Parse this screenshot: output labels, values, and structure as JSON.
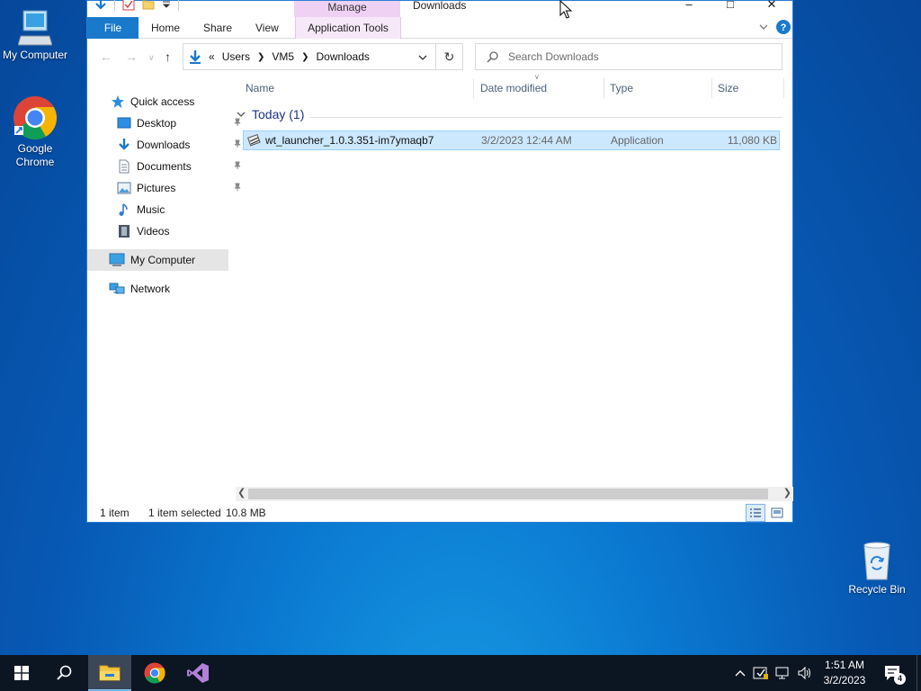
{
  "desktop": {
    "icons": [
      {
        "label": "My Computer"
      },
      {
        "label": "Google Chrome"
      },
      {
        "label": "Recycle Bin"
      }
    ]
  },
  "window": {
    "title": "Downloads",
    "context_tab": "Manage",
    "ribbon_tabs": [
      "File",
      "Home",
      "Share",
      "View",
      "Application Tools"
    ],
    "address": {
      "overflow": "«",
      "crumbs": [
        "Users",
        "VM5",
        "Downloads"
      ]
    },
    "search": {
      "placeholder": "Search Downloads"
    },
    "nav": {
      "quick_access": "Quick access",
      "pinned": [
        "Desktop",
        "Downloads",
        "Documents",
        "Pictures"
      ],
      "others": [
        "Music",
        "Videos"
      ],
      "my_computer": "My Computer",
      "network": "Network"
    },
    "columns": [
      "Name",
      "Date modified",
      "Type",
      "Size"
    ],
    "group": {
      "label": "Today (1)"
    },
    "files": [
      {
        "name": "wt_launcher_1.0.3.351-im7ymaqb7",
        "date": "3/2/2023 12:44 AM",
        "type": "Application",
        "size": "11,080 KB"
      }
    ],
    "status": {
      "count": "1 item",
      "selected": "1 item selected",
      "size": "10.8 MB"
    }
  },
  "taskbar": {
    "clock": {
      "time": "1:51 AM",
      "date": "3/2/2023"
    },
    "notification_count": "4"
  },
  "colors": {
    "accent": "#1979ca",
    "selection": "#cce8ff",
    "taskbar": "#0c1522",
    "context_tab": "#efd1f3"
  }
}
